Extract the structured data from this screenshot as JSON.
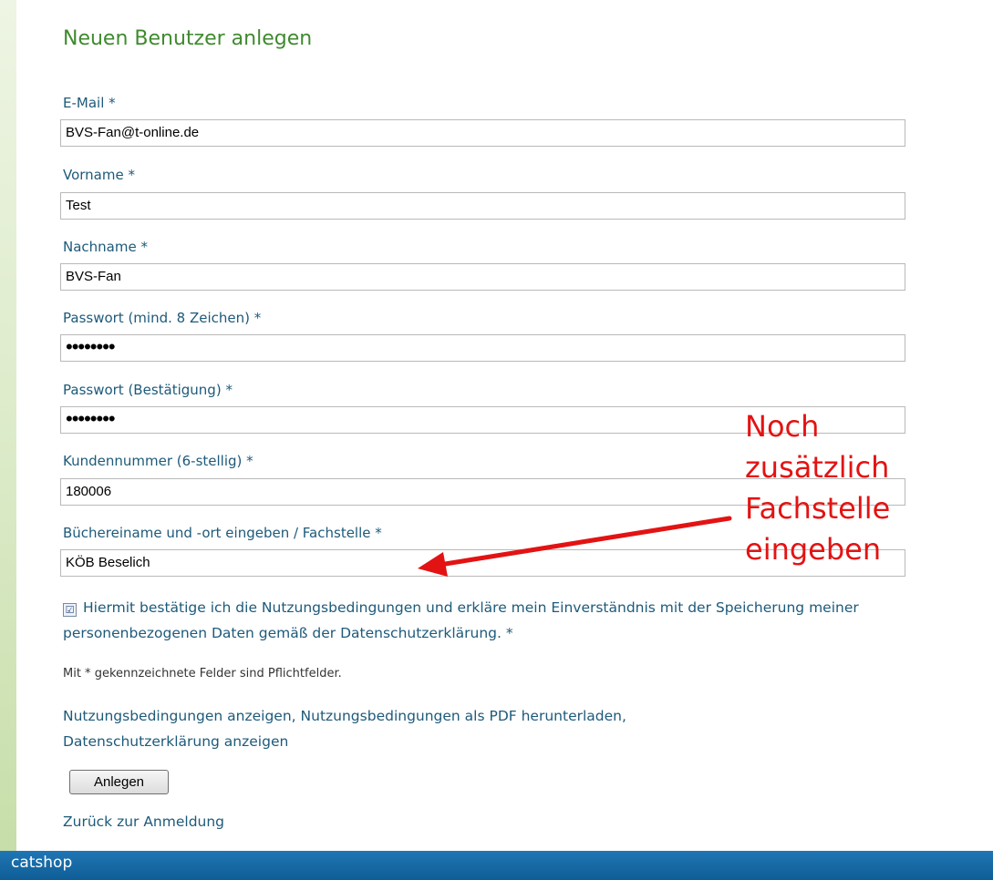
{
  "form": {
    "title": "Neuen Benutzer anlegen",
    "fields": [
      {
        "label": "E-Mail *",
        "value": "BVS-Fan@t-online.de"
      },
      {
        "label": "Vorname *",
        "value": "Test"
      },
      {
        "label": "Nachname *",
        "value": "BVS-Fan"
      },
      {
        "label": "Passwort (mind. 8 Zeichen) *",
        "value": "••••••••"
      },
      {
        "label": "Passwort (Bestätigung) *",
        "value": "••••••••"
      },
      {
        "label": "Kundennummer (6-stellig) *",
        "value": "180006"
      },
      {
        "label": "Büchereiname und -ort eingeben / Fachstelle *",
        "value": "KÖB Beselich"
      }
    ],
    "consent": {
      "checked": true,
      "check_glyph": "☑",
      "text": "Hiermit bestätige ich die Nutzungsbedingungen und erkläre mein Einverständnis mit der Speicherung meiner personenbezogenen Daten gemäß der Datenschutzerklärung. *"
    },
    "required_hint": "Mit * gekennzeichnete Felder sind Pflichtfelder.",
    "links": {
      "terms": "Nutzungsbedingungen anzeigen",
      "terms_pdf": "Nutzungsbedingungen als PDF herunterladen",
      "privacy": "Datenschutzerklärung anzeigen",
      "separator": ","
    },
    "submit_label": "Anlegen",
    "back_link": "Zurück zur Anmeldung"
  },
  "footer": {
    "brand": "catshop"
  },
  "annotation": {
    "lines": [
      "Noch",
      "zusätzlich",
      "Fachstelle",
      "eingeben"
    ],
    "color": "#e31313"
  },
  "colors": {
    "title": "#3f8a2e",
    "label": "#1d5a7a",
    "footer": "#1f76b4"
  }
}
